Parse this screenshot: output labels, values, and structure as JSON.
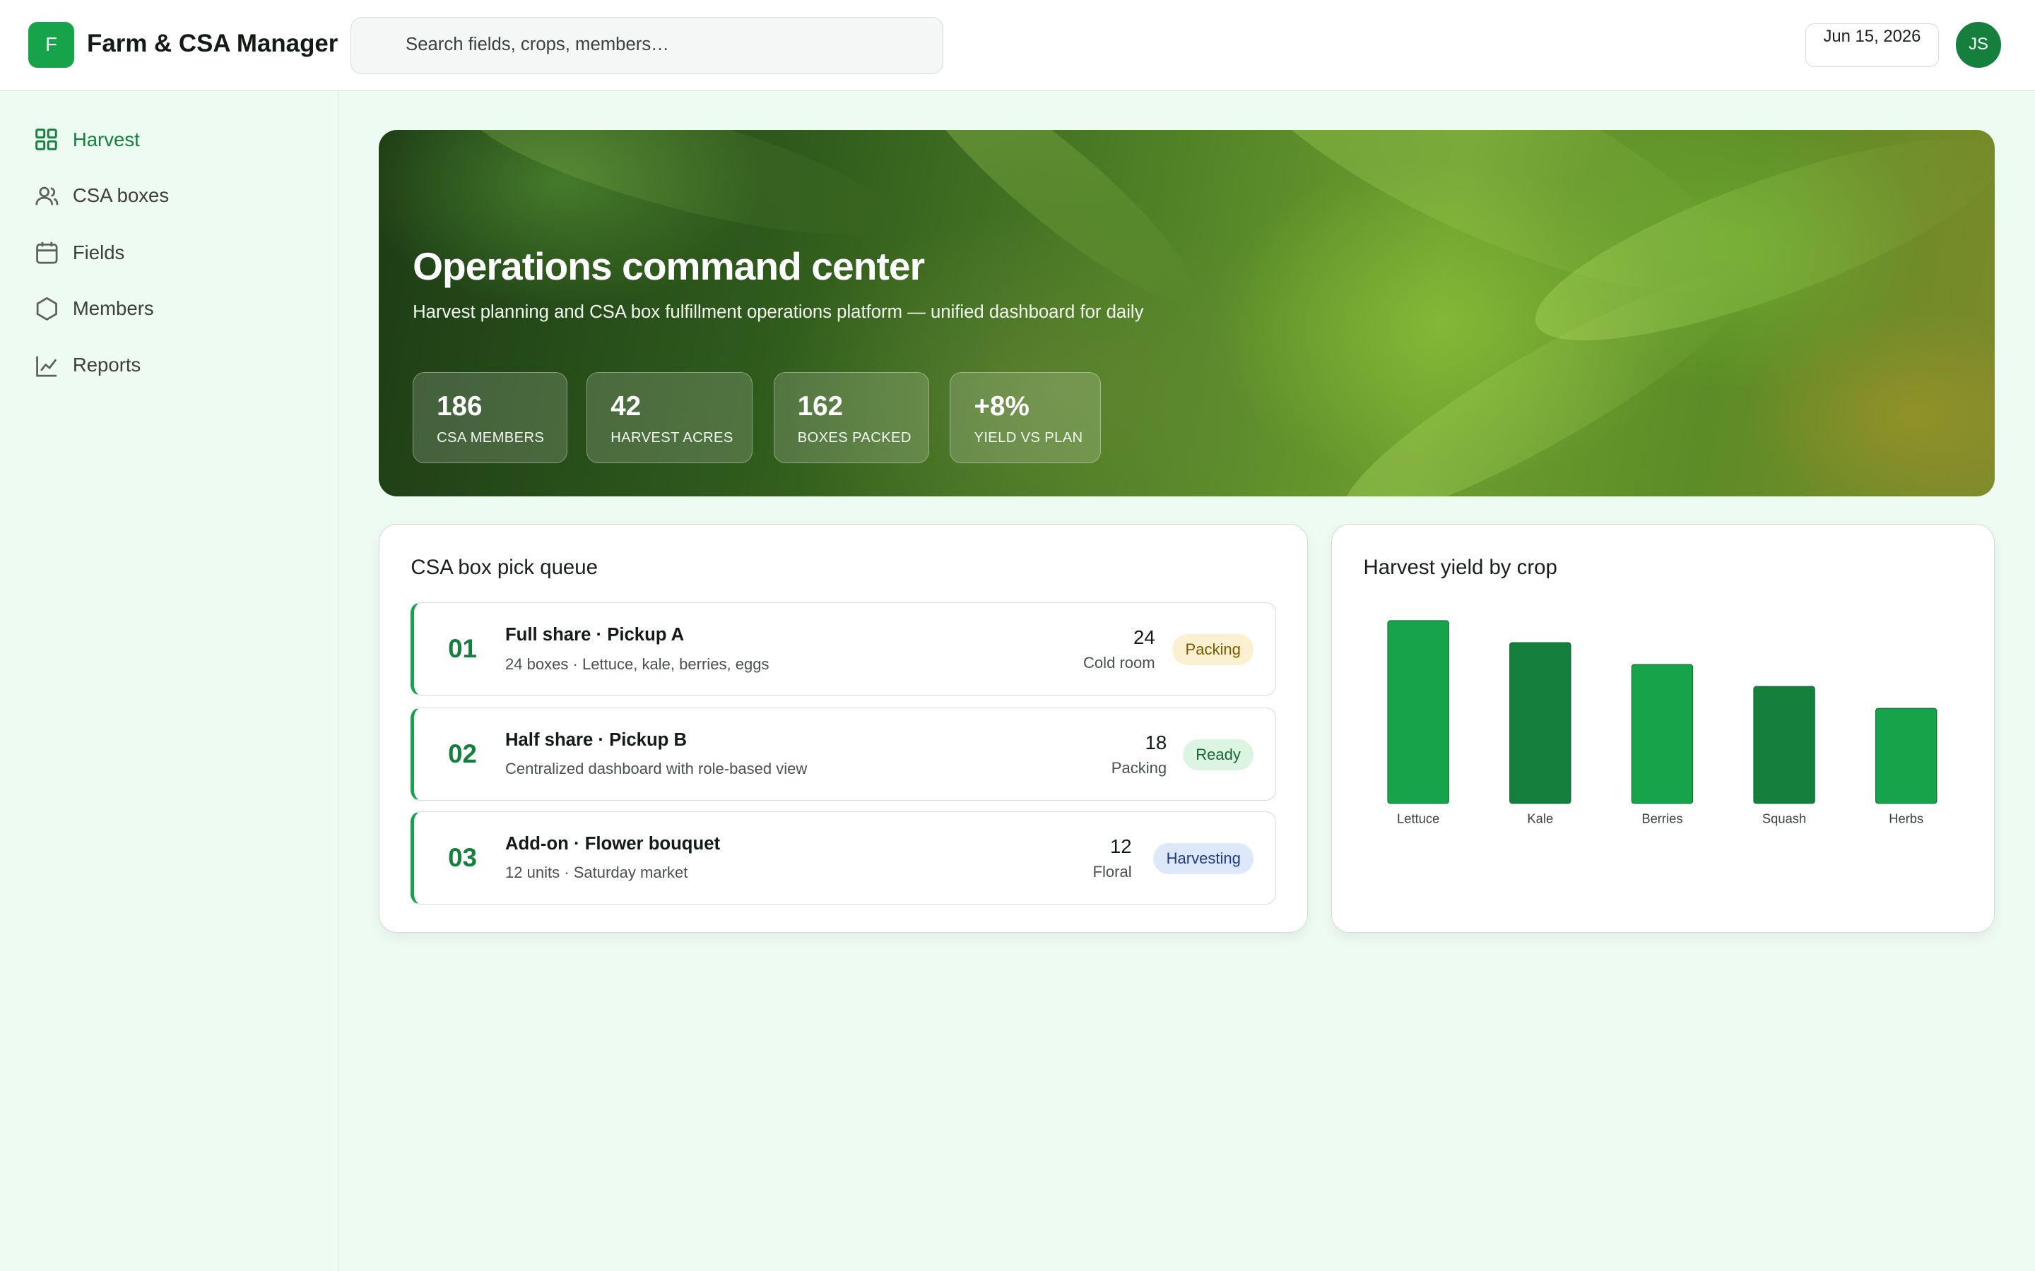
{
  "app": {
    "logo_letter": "F",
    "title": "Farm & CSA Manager"
  },
  "search": {
    "placeholder": "Search fields, crops, members…",
    "icon": "search-icon"
  },
  "header": {
    "date": "Jun 15, 2026",
    "avatar_initials": "JS"
  },
  "sidebar": {
    "items": [
      {
        "label": "Harvest",
        "icon": "grid-icon",
        "active": true
      },
      {
        "label": "CSA boxes",
        "icon": "users-icon",
        "active": false
      },
      {
        "label": "Fields",
        "icon": "calendar-icon",
        "active": false
      },
      {
        "label": "Members",
        "icon": "hexagon-icon",
        "active": false
      },
      {
        "label": "Reports",
        "icon": "line-chart-icon",
        "active": false
      }
    ]
  },
  "hero": {
    "title": "Operations command center",
    "subtitle": "Harvest planning and CSA box fulfillment operations platform — unified dashboard for daily",
    "stats": [
      {
        "value": "186",
        "label": "CSA MEMBERS"
      },
      {
        "value": "42",
        "label": "HARVEST ACRES"
      },
      {
        "value": "162",
        "label": "BOXES PACKED"
      },
      {
        "value": "+8%",
        "label": "YIELD VS PLAN"
      }
    ]
  },
  "queue": {
    "title": "CSA box pick queue",
    "rows": [
      {
        "num": "01",
        "title": "Full share · Pickup A",
        "sub": "24 boxes · Lettuce, kale, berries, eggs",
        "count": "24",
        "location": "Cold room",
        "status": "Packing"
      },
      {
        "num": "02",
        "title": "Half share · Pickup B",
        "sub": "Centralized dashboard with role-based view",
        "count": "18",
        "location": "Packing",
        "status": "Ready"
      },
      {
        "num": "03",
        "title": "Add-on · Flower bouquet",
        "sub": "12 units · Saturday market",
        "count": "12",
        "location": "Floral",
        "status": "Harvesting"
      }
    ]
  },
  "colors": {
    "accent": "#16a34a",
    "accent_dark": "#15803d",
    "bar_light": "#16a34a",
    "bar_dark": "#15803d"
  },
  "chart_data": {
    "type": "bar",
    "title": "Harvest yield by crop",
    "categories": [
      "Lettuce",
      "Kale",
      "Berries",
      "Squash",
      "Herbs"
    ],
    "values": [
      100,
      88,
      76,
      64,
      52
    ],
    "ylim": [
      0,
      100
    ],
    "grid": false,
    "legend": "none"
  }
}
